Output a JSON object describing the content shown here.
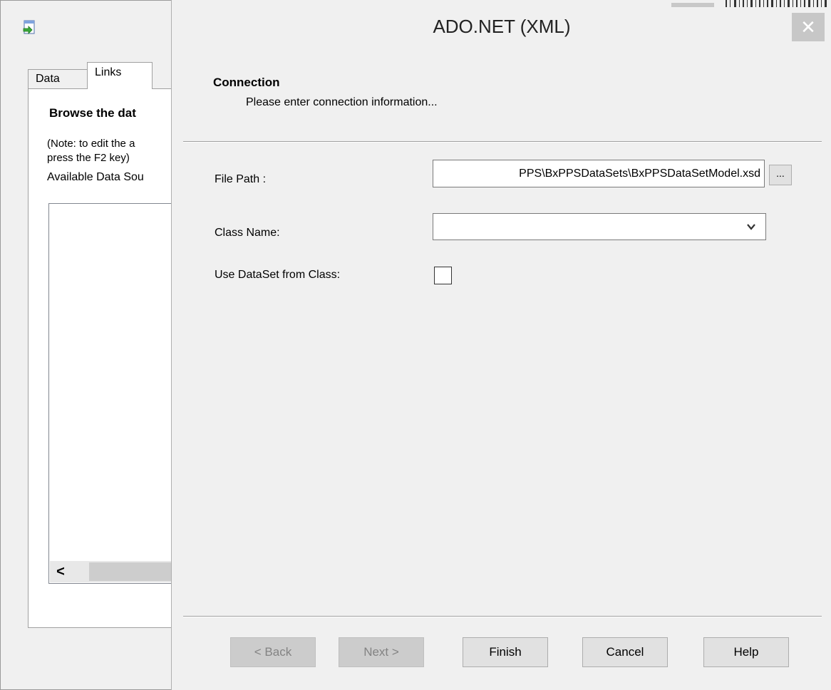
{
  "background_window": {
    "tabs": [
      {
        "label": "Data"
      },
      {
        "label": "Links"
      }
    ],
    "browse_heading": "Browse the dat",
    "note_line1": "(Note: to edit the a",
    "note_line2": "press the F2 key)",
    "available_label": "Available Data Sou",
    "scroll_left_glyph": "<"
  },
  "dialog": {
    "title": "ADO.NET (XML)",
    "close_glyph": "✕",
    "header": {
      "title": "Connection",
      "subtitle": "Please enter connection information..."
    },
    "fields": {
      "file_path": {
        "label": "File Path :",
        "value": "PPS\\BxPPSDataSets\\BxPPSDataSetModel.xsd",
        "browse_label": "..."
      },
      "class_name": {
        "label": "Class Name:",
        "value": ""
      },
      "use_dataset": {
        "label": "Use DataSet from Class:",
        "checked": false
      }
    },
    "buttons": {
      "back": "< Back",
      "next": "Next >",
      "finish": "Finish",
      "cancel": "Cancel",
      "help": "Help"
    }
  },
  "colors": {
    "window_bg": "#f0f0f0",
    "close_button_bg": "#c7c7c7",
    "disabled_text": "#838383"
  }
}
